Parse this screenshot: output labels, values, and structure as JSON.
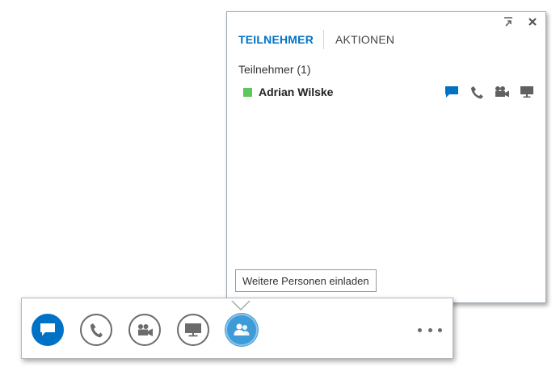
{
  "panel": {
    "tabs": [
      {
        "label": "TEILNEHMER",
        "active": true
      },
      {
        "label": "AKTIONEN",
        "active": false
      }
    ],
    "section_header": "Teilnehmer (1)",
    "participants": [
      {
        "name": "Adrian Wilske",
        "presence_color": "#5cc75e",
        "actions": [
          "chat-icon",
          "phone-icon",
          "video-camera-icon",
          "screen-share-icon"
        ]
      }
    ],
    "controls": [
      "popout-icon",
      "close-icon"
    ]
  },
  "tooltip": {
    "text": "Weitere Personen einladen"
  },
  "toolbar": {
    "buttons": [
      "chat-icon",
      "phone-icon",
      "video-camera-icon",
      "screen-share-icon",
      "people-icon",
      "more-options-icon"
    ],
    "accent_color": "#0072c6",
    "highlight_color": "#3f9ad8"
  }
}
